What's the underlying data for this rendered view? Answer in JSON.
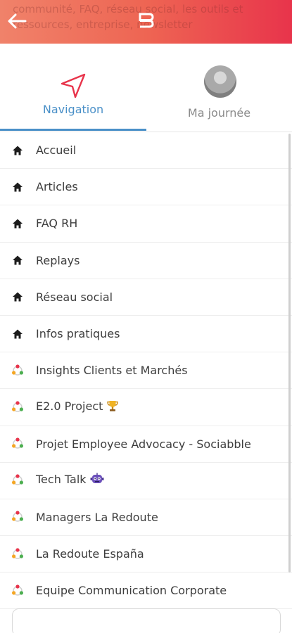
{
  "header": {
    "ghost_text": "communité, FAQ, réseau social, les outils et ressources, entreprise, newsletter",
    "gradient": [
      "#f0826a",
      "#e8344b"
    ]
  },
  "tabs": [
    {
      "label": "Navigation",
      "active": true
    },
    {
      "label": "Ma journée",
      "active": false
    }
  ],
  "colors": {
    "active": "#4a90c8",
    "text": "#3d3d3d"
  },
  "menu": [
    {
      "label": "Accueil",
      "icon": "home-icon"
    },
    {
      "label": "Articles",
      "icon": "home-icon"
    },
    {
      "label": "FAQ RH",
      "icon": "home-icon"
    },
    {
      "label": "Replays",
      "icon": "home-icon"
    },
    {
      "label": "Réseau social",
      "icon": "home-icon"
    },
    {
      "label": "Infos pratiques",
      "icon": "home-icon"
    },
    {
      "label": "Insights Clients et Marchés",
      "icon": "community-icon"
    },
    {
      "label": "E2.0 Project",
      "icon": "community-icon",
      "emoji": "trophy-icon"
    },
    {
      "label": "Projet Employee Advocacy - Sociabble",
      "icon": "community-icon"
    },
    {
      "label": "Tech Talk",
      "icon": "community-icon",
      "emoji": "robot-icon"
    },
    {
      "label": "Managers La Redoute",
      "icon": "community-icon"
    },
    {
      "label": "La Redoute España",
      "icon": "community-icon"
    },
    {
      "label": "Equipe Communication Corporate",
      "icon": "community-icon"
    }
  ]
}
